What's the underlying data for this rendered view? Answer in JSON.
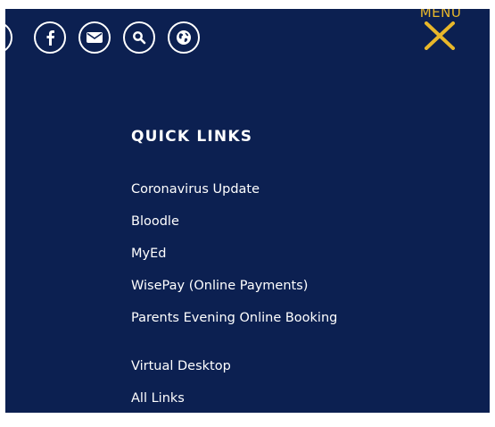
{
  "social_icons": [
    {
      "name": "twitter-icon"
    },
    {
      "name": "facebook-icon"
    },
    {
      "name": "email-icon"
    },
    {
      "name": "search-icon"
    },
    {
      "name": "globe-icon"
    }
  ],
  "menu": {
    "label": "MENU",
    "accent_color": "#e8b72a"
  },
  "quick_links": {
    "title": "QUICK LINKS",
    "items": [
      {
        "label": "Coronavirus Update"
      },
      {
        "label": "Bloodle"
      },
      {
        "label": "MyEd"
      },
      {
        "label": "WisePay (Online Payments)"
      },
      {
        "label": "Parents Evening Online Booking"
      },
      {
        "label": "Virtual Desktop"
      },
      {
        "label": "All Links"
      }
    ]
  },
  "colors": {
    "panel_background": "#0c2051",
    "text": "#ffffff"
  }
}
